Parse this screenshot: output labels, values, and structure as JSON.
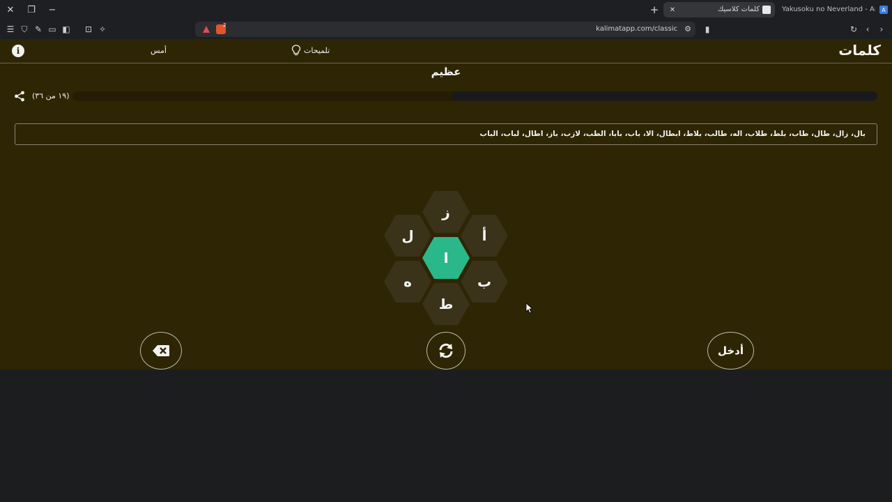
{
  "browser": {
    "tabs": [
      {
        "title": "كلمات كلاسيك",
        "active": true
      },
      {
        "title": "Yakusoku no Neverland - Anime Slay",
        "active": false
      }
    ],
    "url": "kalimatapp.com/classic",
    "shield_count": "2"
  },
  "header": {
    "brand": "كلمات",
    "hints_label": "تلميحات",
    "yesterday_label": "أمس"
  },
  "game": {
    "rank": "عظيم",
    "count_text": "(١٩ من ٣٦)",
    "progress": {
      "found": 19,
      "total": 36
    },
    "found_words": "بال، زال، طال، طاب، بلط، طلاب، اله، طالب، بلاط، ابطال، الا، باب، بابا، الطب، لازب، باز، اطال، لباب، الباب",
    "letters": {
      "center": "ا",
      "top": "ز",
      "top_left": "ل",
      "top_right": "أ",
      "bottom_left": "ه",
      "bottom_right": "ب",
      "bottom": "ط"
    },
    "enter_label": "أدخل"
  },
  "colors": {
    "page_bg": "#2e2504",
    "hex_bg": "#3a3219",
    "center_hex": "#2ab88a"
  }
}
